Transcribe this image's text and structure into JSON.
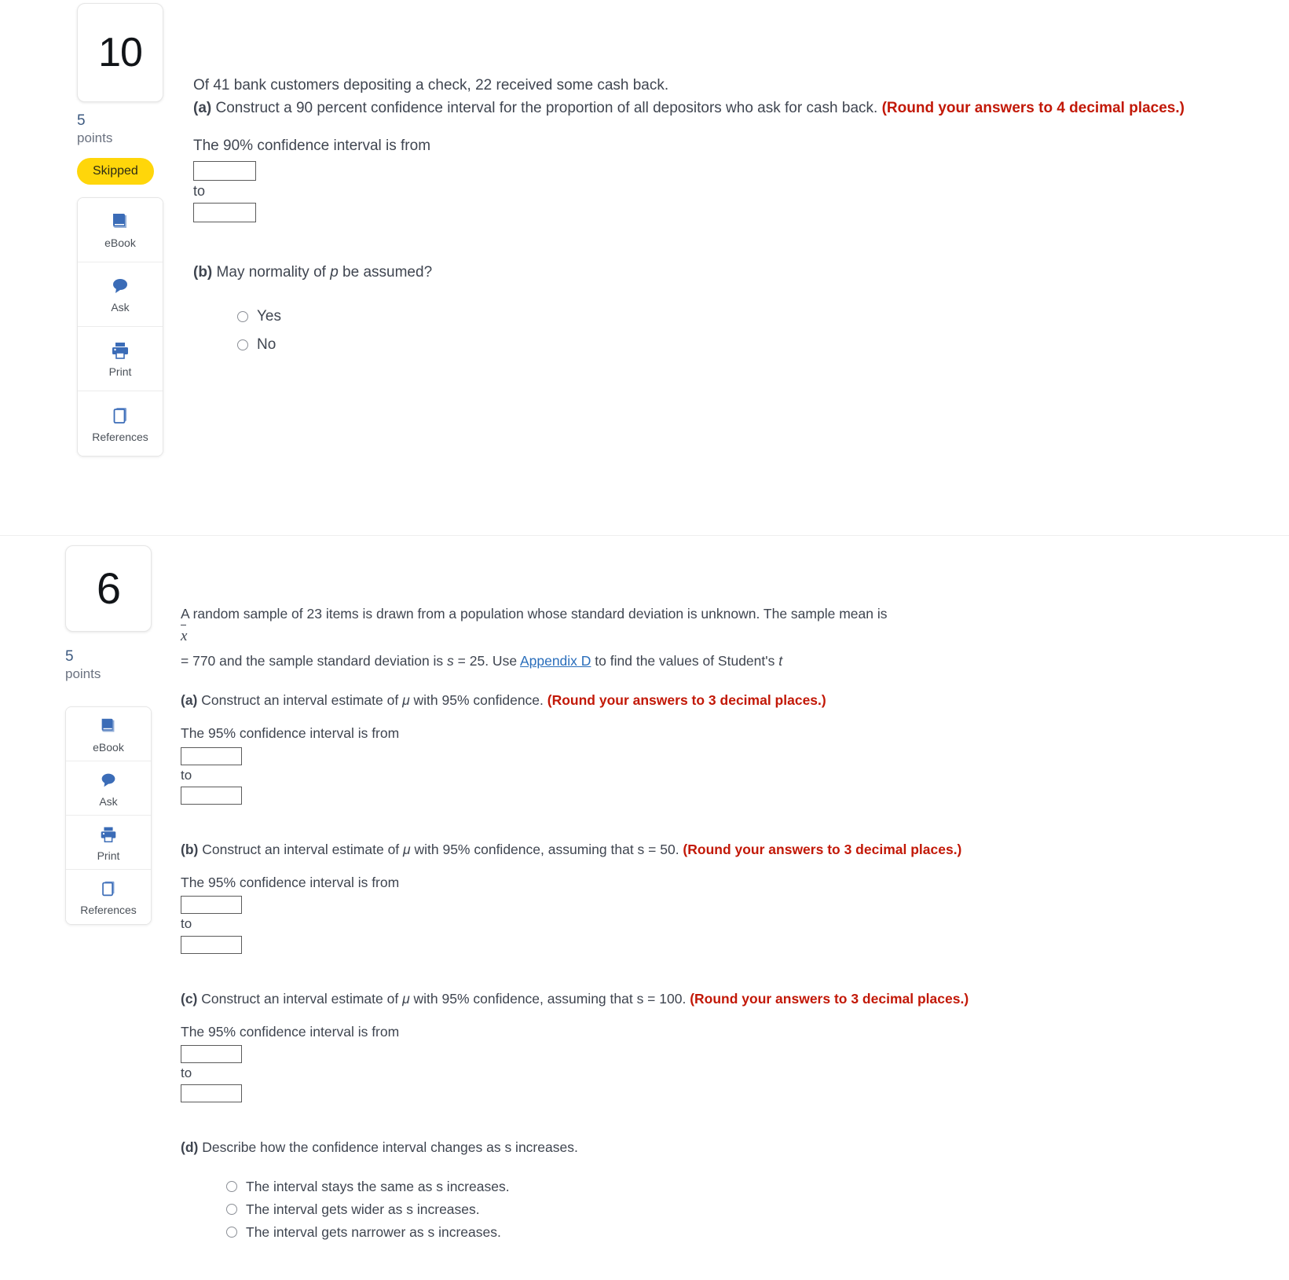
{
  "questions": [
    {
      "number": "10",
      "points_value": "5",
      "points_label": "points",
      "status_badge": "Skipped",
      "tools": [
        {
          "label": "eBook",
          "icon": "ebook-icon"
        },
        {
          "label": "Ask",
          "icon": "ask-icon"
        },
        {
          "label": "Print",
          "icon": "print-icon"
        },
        {
          "label": "References",
          "icon": "references-icon"
        }
      ],
      "stem": "Of 41 bank customers depositing a check, 22 received some cash back.",
      "part_a": {
        "marker": "(a)",
        "text": " Construct a 90 percent confidence interval for the proportion of all depositors who ask for cash back. ",
        "red": "(Round your answers to 4 decimal places.)",
        "answer_label": "The 90% confidence interval is from",
        "to_label": "to",
        "value_from": "",
        "value_to": ""
      },
      "part_b": {
        "marker": "(b)",
        "text_before": " May normality of ",
        "symbol": "p",
        "text_after": " be assumed?",
        "options": [
          "Yes",
          "No"
        ]
      }
    },
    {
      "number": "6",
      "points_value": "5",
      "points_label": "points",
      "tools": [
        {
          "label": "eBook",
          "icon": "ebook-icon"
        },
        {
          "label": "Ask",
          "icon": "ask-icon"
        },
        {
          "label": "Print",
          "icon": "print-icon"
        },
        {
          "label": "References",
          "icon": "references-icon"
        }
      ],
      "stem_line1": "A random sample of 23 items is drawn from a population whose standard deviation is unknown. The sample mean is",
      "stem_xbar": "x",
      "stem_line2_a": "= 770 and the sample standard deviation is ",
      "stem_s": "s",
      "stem_line2_b": " = 25. Use ",
      "stem_link": "Appendix D",
      "stem_line2_c": " to find the values of Student's ",
      "stem_t": "t",
      "parts": [
        {
          "marker": "(a)",
          "text_before": " Construct an interval estimate of ",
          "mu": "μ",
          "text_after": " with 95% confidence. ",
          "red": "(Round your answers to 3 decimal places.)",
          "answer_label": "The 95% confidence interval is from",
          "to_label": "to",
          "value_from": "",
          "value_to": ""
        },
        {
          "marker": "(b)",
          "text_before": " Construct an interval estimate of ",
          "mu": "μ",
          "text_after": " with 95% confidence, assuming that s = 50. ",
          "red": "(Round your answers to 3 decimal places.)",
          "answer_label": "The 95% confidence interval is from",
          "to_label": "to",
          "value_from": "",
          "value_to": ""
        },
        {
          "marker": "(c)",
          "text_before": " Construct an interval estimate of ",
          "mu": "μ",
          "text_after": " with 95% confidence, assuming that s = 100. ",
          "red": "(Round your answers to 3 decimal places.)",
          "answer_label": "The 95% confidence interval is from",
          "to_label": "to",
          "value_from": "",
          "value_to": ""
        }
      ],
      "part_d": {
        "marker": "(d)",
        "text": " Describe how the confidence interval changes as s increases.",
        "options": [
          "The interval stays the same as s increases.",
          "The interval gets wider as s increases.",
          "The interval gets narrower as s increases."
        ]
      }
    }
  ],
  "colors": {
    "red_instruction": "#c21807",
    "badge_yellow": "#ffd60a",
    "icon_blue": "#3b6cb7",
    "link_blue": "#2a6ebb"
  }
}
